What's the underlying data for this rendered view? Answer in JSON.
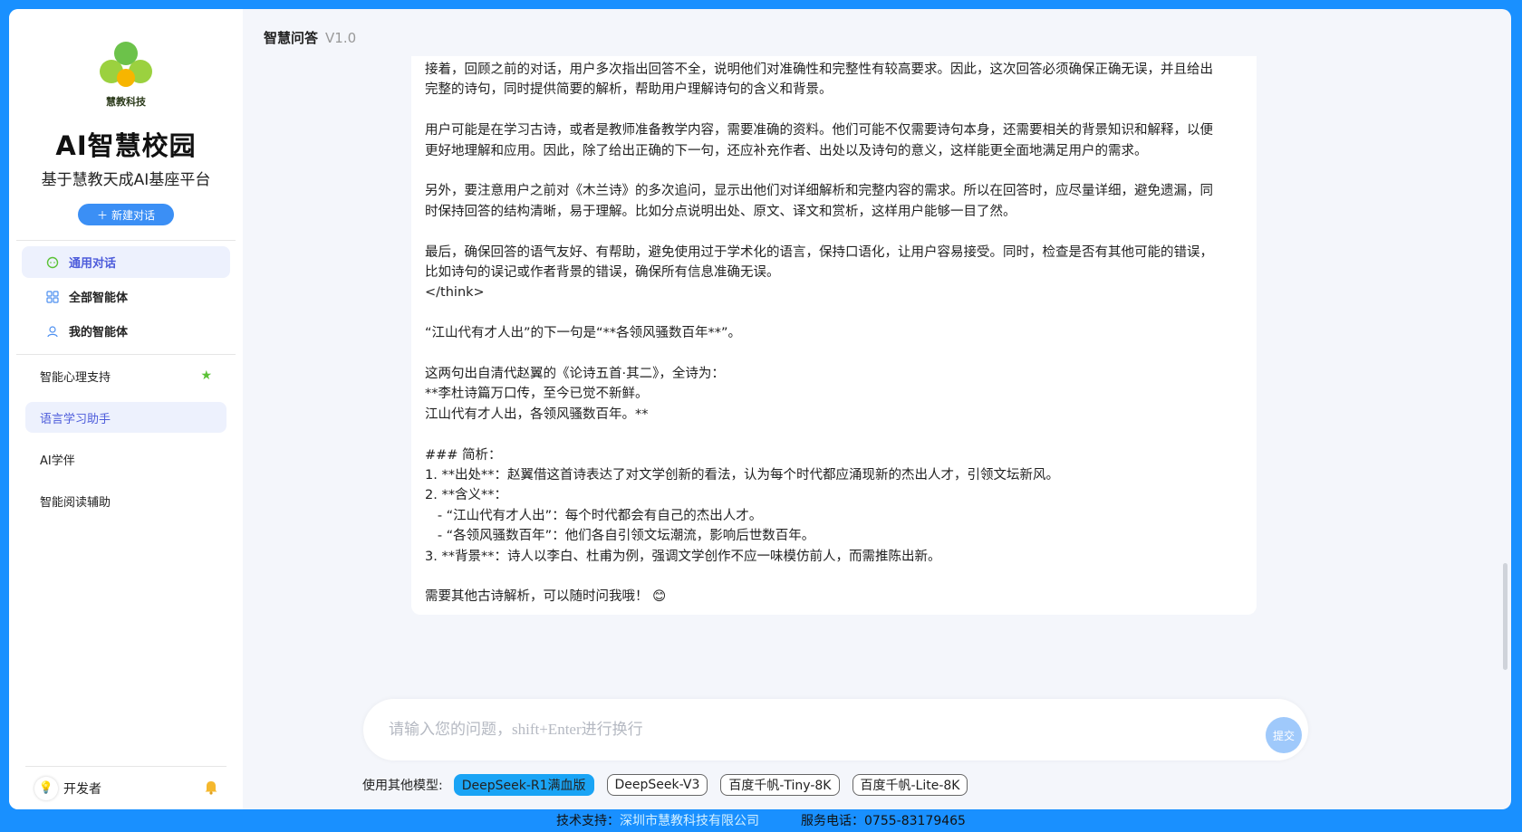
{
  "sidebar": {
    "logo_text": "慧教科技",
    "app_title": "AI智慧校园",
    "app_subtitle": "基于慧教天成AI基座平台",
    "new_chat_label": "新建对话",
    "nav": [
      {
        "label": "通用对话",
        "icon": "chat-icon",
        "active": true
      },
      {
        "label": "全部智能体",
        "icon": "grid-icon",
        "active": false
      },
      {
        "label": "我的智能体",
        "icon": "user-icon",
        "active": false
      }
    ],
    "agents": [
      {
        "label": "智能心理支持",
        "starred": true
      },
      {
        "label": "语言学习助手",
        "active": true
      },
      {
        "label": "AI学伴"
      },
      {
        "label": "智能阅读辅助"
      }
    ],
    "user_name": "开发者"
  },
  "header": {
    "title": "智慧问答",
    "version": "V1.0"
  },
  "chat": {
    "lines": [
      "接着，回顾之前的对话，用户多次指出回答不全，说明他们对准确性和完整性有较高要求。因此，这次回答必须确保正确无误，并且给出",
      "完整的诗句，同时提供简要的解析，帮助用户理解诗句的含义和背景。",
      "",
      "用户可能是在学习古诗，或者是教师准备教学内容，需要准确的资料。他们可能不仅需要诗句本身，还需要相关的背景知识和解释，以便",
      "更好地理解和应用。因此，除了给出正确的下一句，还应补充作者、出处以及诗句的意义，这样能更全面地满足用户的需求。",
      "",
      "另外，要注意用户之前对《木兰诗》的多次追问，显示出他们对详细解析和完整内容的需求。所以在回答时，应尽量详细，避免遗漏，同",
      "时保持回答的结构清晰，易于理解。比如分点说明出处、原文、译文和赏析，这样用户能够一目了然。",
      "",
      "最后，确保回答的语气友好、有帮助，避免使用过于学术化的语言，保持口语化，让用户容易接受。同时，检查是否有其他可能的错误，",
      "比如诗句的误记或作者背景的错误，确保所有信息准确无误。",
      "</think>",
      "",
      "“江山代有才人出”的下一句是“**各领风骚数百年**”。",
      "",
      "这两句出自清代赵翼的《论诗五首·其二》，全诗为：",
      "**李杜诗篇万口传，至今已觉不新鲜。",
      "江山代有才人出，各领风骚数百年。**",
      "",
      "### 简析：",
      "1. **出处**：赵翼借这首诗表达了对文学创新的看法，认为每个时代都应涌现新的杰出人才，引领文坛新风。",
      "2. **含义**：",
      "   - “江山代有才人出”：每个时代都会有自己的杰出人才。",
      "   - “各领风骚数百年”：他们各自引领文坛潮流，影响后世数百年。",
      "3. **背景**：诗人以李白、杜甫为例，强调文学创作不应一味模仿前人，而需推陈出新。",
      "",
      "需要其他古诗解析，可以随时问我哦！ 😊"
    ]
  },
  "input": {
    "placeholder": "请输入您的问题，shift+Enter进行换行",
    "submit_label": "提交"
  },
  "models": {
    "label": "使用其他模型:",
    "options": [
      {
        "label": "DeepSeek-R1满血版",
        "active": true
      },
      {
        "label": "DeepSeek-V3",
        "active": false
      },
      {
        "label": "百度千帆-Tiny-8K",
        "active": false
      },
      {
        "label": "百度千帆-Lite-8K",
        "active": false
      }
    ]
  },
  "footer": {
    "support_label": "技术支持：",
    "company": "深圳市慧教科技有限公司",
    "phone_label": "服务电话：0755-83179465"
  },
  "colors": {
    "background": "#1990ff",
    "accent": "#3b8ff5",
    "active_bg": "#edf1fd",
    "active_text": "#4d5cdb",
    "model_active": "#1aa4f5"
  }
}
